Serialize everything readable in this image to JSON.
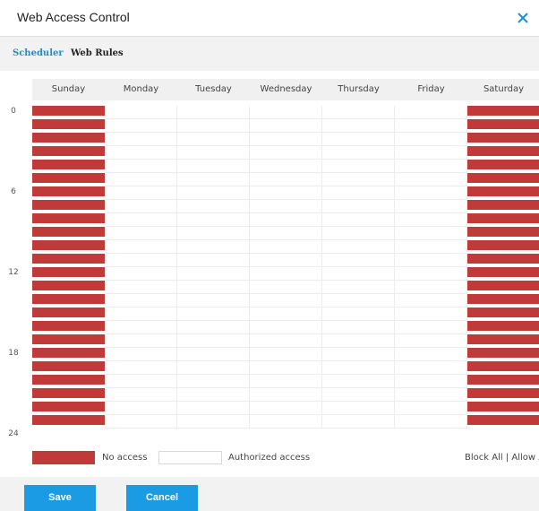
{
  "dialog": {
    "title": "Web Access Control"
  },
  "tabs": [
    {
      "label": "Scheduler",
      "active": true
    },
    {
      "label": "Web Rules",
      "active": false
    }
  ],
  "days": [
    "Sunday",
    "Monday",
    "Tuesday",
    "Wednesday",
    "Thursday",
    "Friday",
    "Saturday"
  ],
  "hour_labels": [
    "0",
    "6",
    "12",
    "18",
    "24"
  ],
  "slots": 24,
  "schedule": {
    "Sunday": "no-access",
    "Monday": "authorized",
    "Tuesday": "authorized",
    "Wednesday": "authorized",
    "Thursday": "authorized",
    "Friday": "authorized",
    "Saturday": "no-access"
  },
  "legend": {
    "no_access": "No access",
    "authorized": "Authorized access"
  },
  "actions": {
    "block_all": "Block All",
    "separator": "|",
    "allow_all": "Allow Al"
  },
  "buttons": {
    "save": "Save",
    "cancel": "Cancel"
  },
  "colors": {
    "no_access": "#c13a3a",
    "authorized": "#ffffff",
    "accent": "#1a9be3"
  }
}
